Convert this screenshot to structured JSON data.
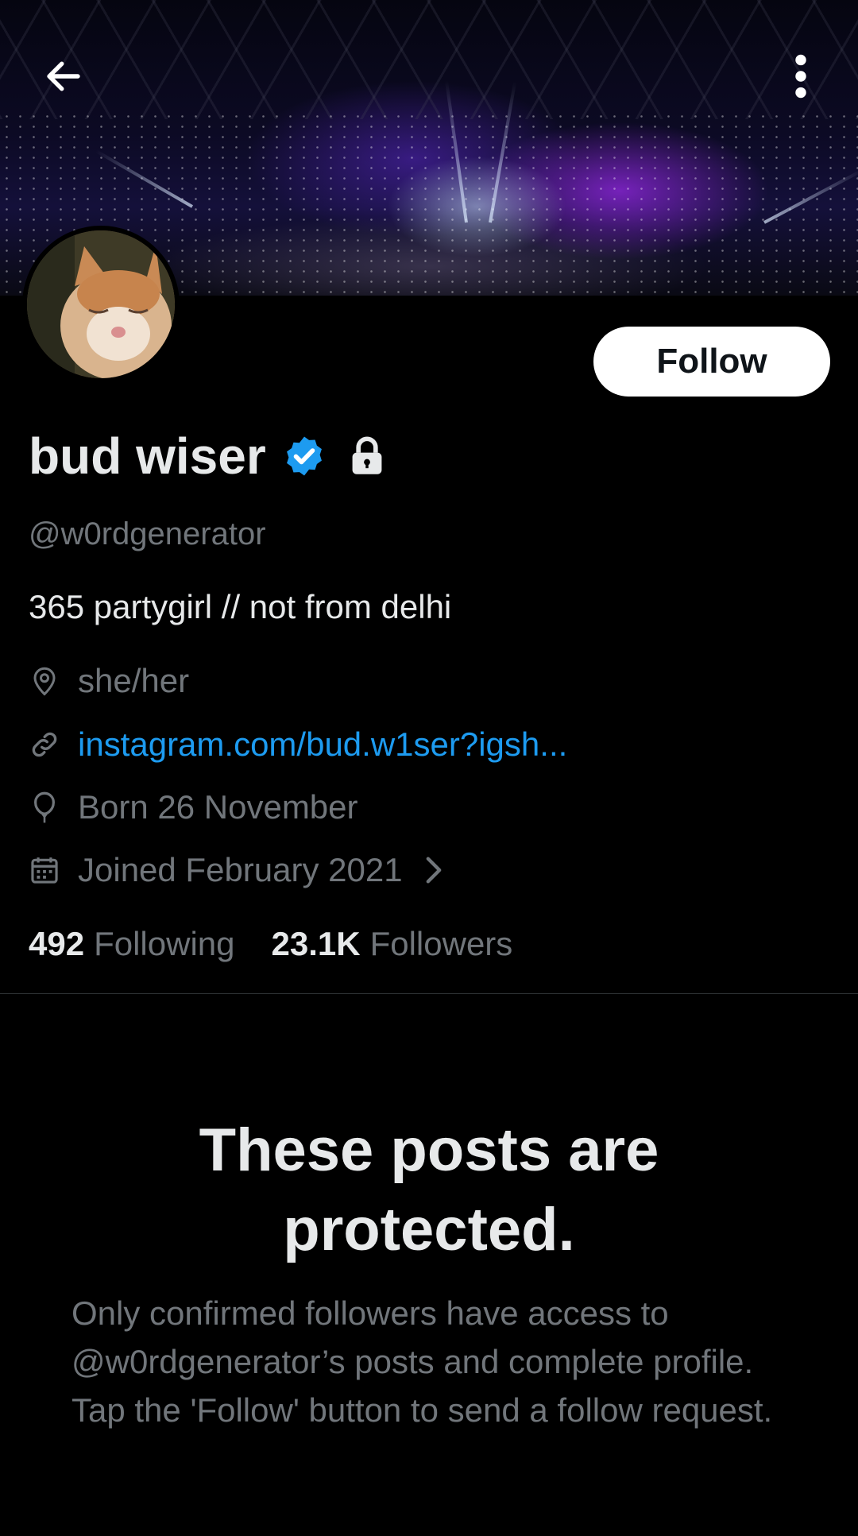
{
  "profile": {
    "display_name": "bud wiser",
    "handle": "@w0rdgenerator",
    "bio": "365 partygirl // not from delhi",
    "pronouns": "she/her",
    "link": "instagram.com/bud.w1ser?igsh...",
    "birthday": "Born 26 November",
    "joined": "Joined February 2021",
    "following_count": "492",
    "following_label": "Following",
    "followers_count": "23.1K",
    "followers_label": "Followers"
  },
  "actions": {
    "follow_label": "Follow"
  },
  "protected": {
    "title": "These posts are protected.",
    "body": "Only confirmed followers have access to @w0rdgenerator’s posts and complete profile. Tap the 'Follow' button to send a follow request."
  },
  "icons": {
    "back": "arrow-left-icon",
    "more": "more-vertical-icon",
    "verified": "verified-badge-icon",
    "lock": "lock-icon",
    "location": "location-pin-icon",
    "link": "link-icon",
    "birthday": "balloon-icon",
    "joined": "calendar-icon",
    "chevron": "chevron-right-icon"
  },
  "colors": {
    "background": "#000000",
    "primary_text": "#e7e9ea",
    "secondary_text": "#71767b",
    "link": "#1d9bf0",
    "verified": "#1d9bf0",
    "follow_button_bg": "#ffffff"
  }
}
